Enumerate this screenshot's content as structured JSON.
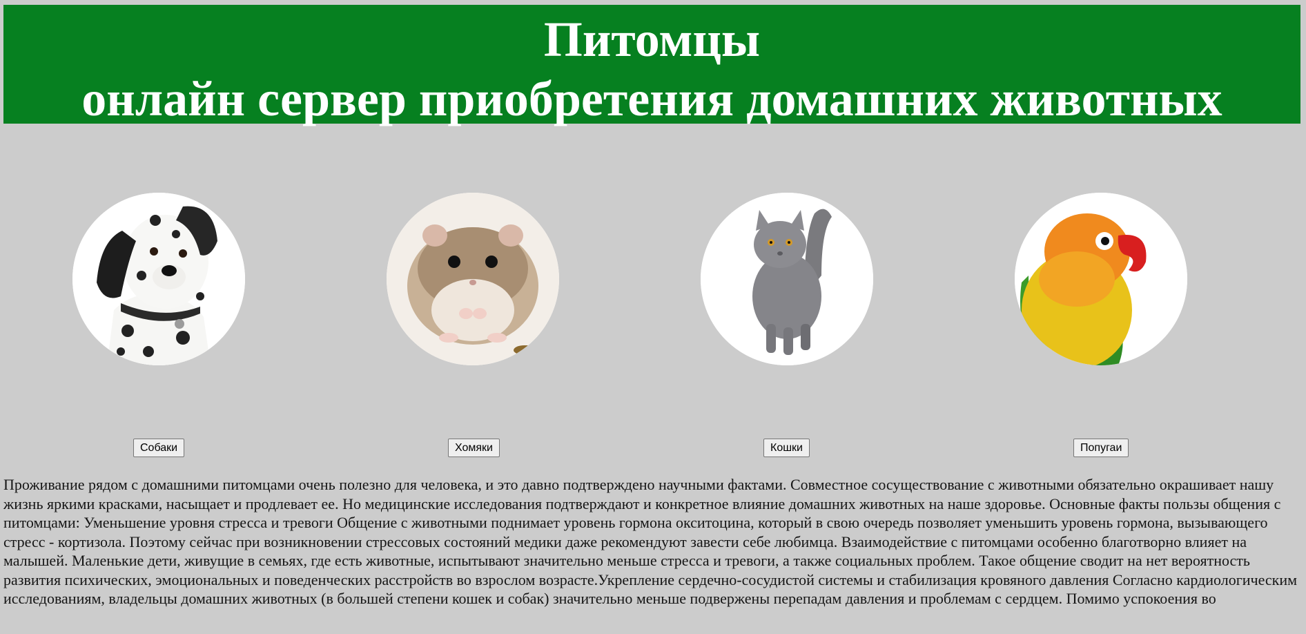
{
  "header": {
    "title": "Питомцы",
    "subtitle": "онлайн сервер приобретения домашних животных"
  },
  "pets": [
    {
      "label": "Собаки",
      "image_icon": "dalmatian-dog-icon"
    },
    {
      "label": "Хомяки",
      "image_icon": "hamster-icon"
    },
    {
      "label": "Кошки",
      "image_icon": "grey-cat-icon"
    },
    {
      "label": "Попугаи",
      "image_icon": "lovebird-parrot-icon"
    }
  ],
  "article": {
    "text": "Проживание рядом с домашними питомцами очень полезно для человека, и это давно подтверждено научными фактами. Совместное сосуществование с животными обязательно окрашивает нашу жизнь яркими красками, насыщает и продлевает ее. Но медицинские исследования подтверждают и конкретное влияние домашних животных на наше здоровье. Основные факты пользы общения с питомцами: Уменьшение уровня стресса и тревоги Общение с животными поднимает уровень гормона окситоцина, который в свою очередь позволяет уменьшить уровень гормона, вызывающего стресс - кортизола. Поэтому сейчас при возникновении стрессовых состояний медики даже рекомендуют завести себе любимца. Взаимодействие с питомцами особенно благотворно влияет на малышей. Маленькие дети, живущие в семьях, где есть животные, испытывают значительно меньше стресса и тревоги, а также социальных проблем. Такое общение сводит на нет вероятность развития психических, эмоциональных и поведенческих расстройств во взрослом возрасте.Укрепление сердечно-сосудистой системы и стабилизация кровяного давления Согласно кардиологическим исследованиям, владельцы домашних животных (в большей степени кошек и собак) значительно меньше подвержены перепадам давления и проблемам с сердцем. Помимо успокоения во"
  },
  "colors": {
    "header_bg": "#068020",
    "page_bg": "#cccccc"
  }
}
